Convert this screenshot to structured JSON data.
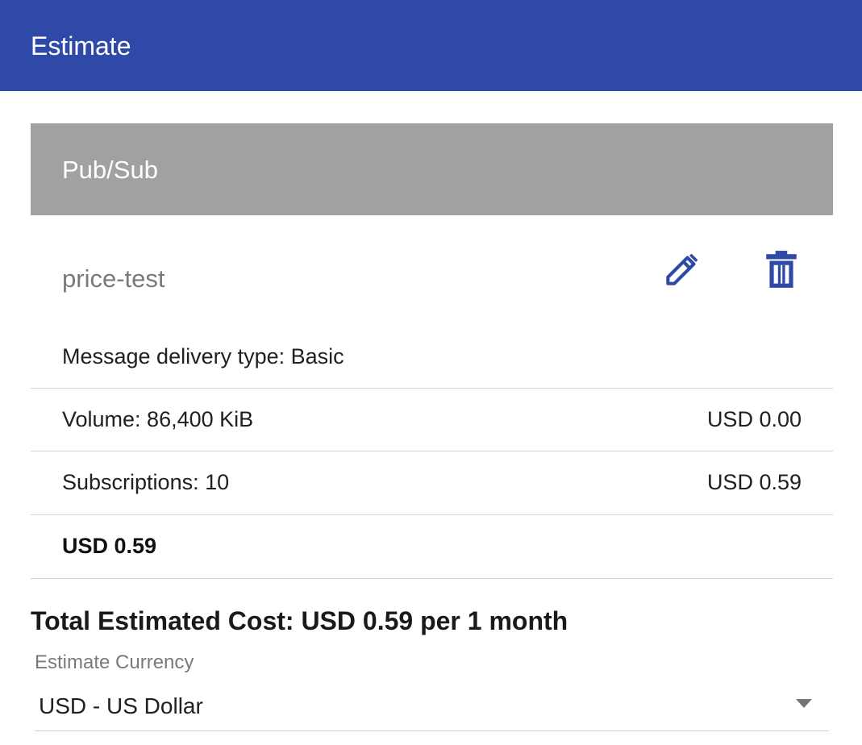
{
  "header": {
    "title": "Estimate",
    "color": "#2f49a8"
  },
  "card": {
    "service": "Pub/Sub",
    "item_name": "price-test",
    "edit_icon": "pencil-icon",
    "delete_icon": "trash-icon",
    "icon_color": "#2f49a8",
    "delivery_type": "Message delivery type: Basic",
    "rows": [
      {
        "label": "Volume: 86,400 KiB",
        "value": "USD 0.00"
      },
      {
        "label": "Subscriptions: 10",
        "value": "USD 0.59"
      }
    ],
    "subtotal": "USD 0.59"
  },
  "total": {
    "text": "Total Estimated Cost: USD 0.59 per 1 month"
  },
  "currency": {
    "label": "Estimate Currency",
    "selected": "USD - US Dollar",
    "caret_icon": "dropdown-arrow-icon"
  }
}
